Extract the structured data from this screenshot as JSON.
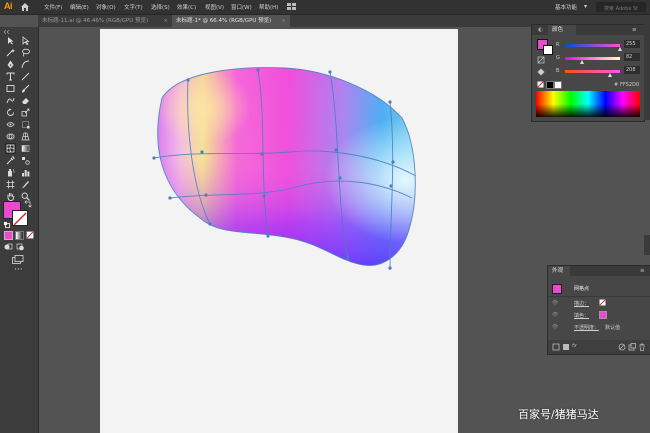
{
  "app": {
    "logo": "Ai"
  },
  "menu": {
    "items": [
      "文件(F)",
      "编辑(E)",
      "对象(O)",
      "文字(T)",
      "选择(S)",
      "效果(C)",
      "视图(V)",
      "窗口(W)",
      "帮助(H)"
    ],
    "workspace_label": "基本功能",
    "search_placeholder": "搜索 Adobe St"
  },
  "tabs": [
    {
      "label": "未标题-11.ai @ 46.46% (RGB/GPU 预览)",
      "active": false
    },
    {
      "label": "未标题-1* @ 66.4% (RGB/GPU 预览)",
      "active": true
    }
  ],
  "color_panel": {
    "tab_label": "颜色",
    "channels": [
      {
        "name": "R",
        "value": "255",
        "fraction": 1.0
      },
      {
        "name": "G",
        "value": "82",
        "fraction": 0.32
      },
      {
        "name": "B",
        "value": "208",
        "fraction": 0.82
      }
    ],
    "hex_value": "FF52D0",
    "accent": "#e84ad0"
  },
  "appearance_panel": {
    "tab_label": "外观",
    "object_label": "网格点",
    "stroke_label": "描边：",
    "fill_label": "填色：",
    "opacity_label": "不透明度：",
    "opacity_value": "默认值"
  },
  "watermark": "百家号/猪猪马达",
  "colors": {
    "fill_swatch": "#e84ad0",
    "artboard": "#f3f3f3",
    "workspace": "#535353"
  }
}
